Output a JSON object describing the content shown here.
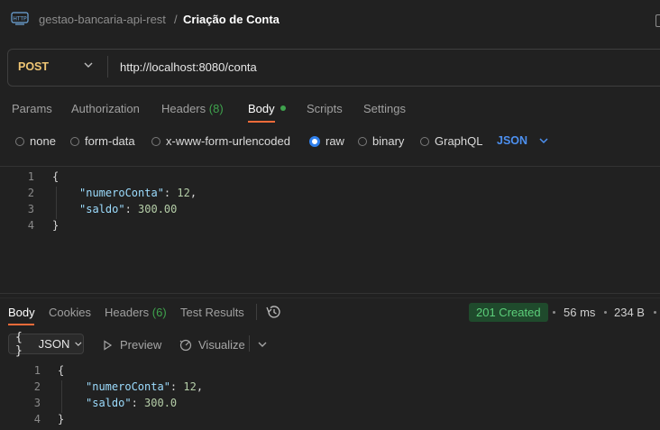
{
  "header": {
    "icon": "http-request-icon",
    "collection": "gestao-bancaria-api-rest",
    "separator": "/",
    "request_name": "Criação de Conta"
  },
  "request": {
    "method": "POST",
    "url": "http://localhost:8080/conta"
  },
  "request_tabs": {
    "params": "Params",
    "authorization": "Authorization",
    "headers": "Headers",
    "headers_count": "(8)",
    "body": "Body",
    "scripts": "Scripts",
    "settings": "Settings",
    "active": "Body"
  },
  "body_types": {
    "none": "none",
    "form_data": "form-data",
    "urlencoded": "x-www-form-urlencoded",
    "raw": "raw",
    "binary": "binary",
    "graphql": "GraphQL",
    "selected": "raw",
    "language": "JSON"
  },
  "request_body": {
    "line_numbers": [
      "1",
      "2",
      "3",
      "4"
    ],
    "open_brace": "{",
    "key1": "\"numeroConta\"",
    "val1": "12",
    "key2": "\"saldo\"",
    "val2": "300.00",
    "close_brace": "}"
  },
  "response_tabs": {
    "body": "Body",
    "cookies": "Cookies",
    "headers": "Headers",
    "headers_count": "(6)",
    "test_results": "Test Results",
    "active": "Body"
  },
  "response_meta": {
    "status": "201 Created",
    "time": "56 ms",
    "size": "234 B",
    "status_color": "#5ccf7a"
  },
  "response_toolbar": {
    "format_icon": "{ }",
    "format": "JSON",
    "preview": "Preview",
    "visualize": "Visualize"
  },
  "response_body": {
    "line_numbers": [
      "1",
      "2",
      "3",
      "4"
    ],
    "open_brace": "{",
    "key1": "\"numeroConta\"",
    "val1": "12",
    "key2": "\"saldo\"",
    "val2": "300.0",
    "close_brace": "}"
  },
  "colors": {
    "accent_tab": "#f26b3a",
    "method": "#f0c674",
    "selected_radio": "#2f80ed",
    "json_key": "#9cdcfe",
    "json_number": "#b5cea8"
  }
}
